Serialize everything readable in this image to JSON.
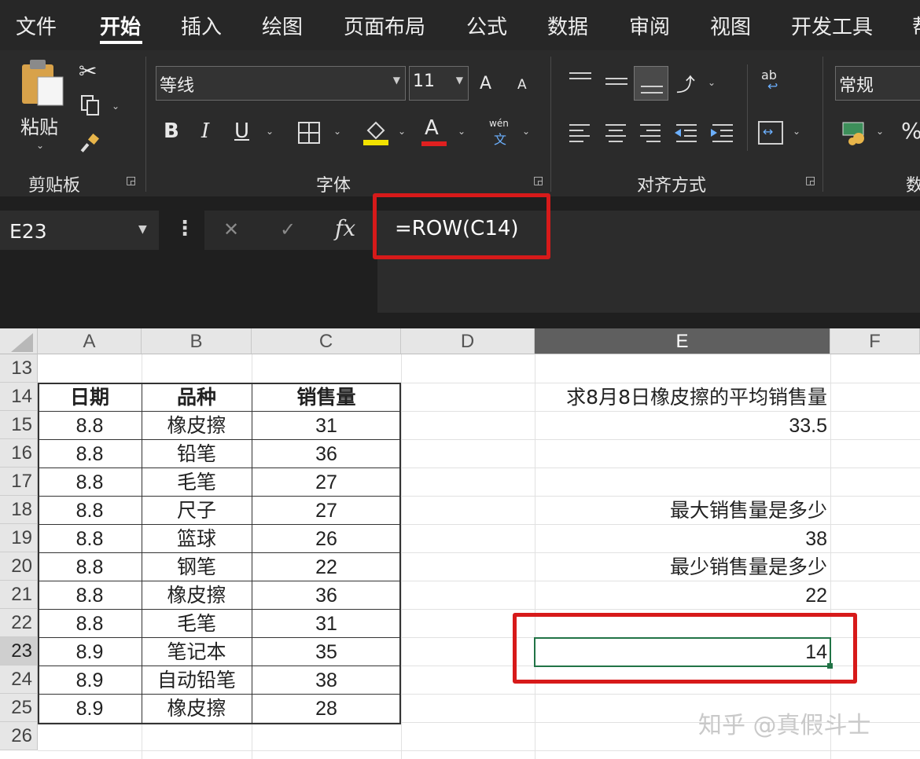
{
  "menu": {
    "tabs": [
      "文件",
      "开始",
      "插入",
      "绘图",
      "页面布局",
      "公式",
      "数据",
      "审阅",
      "视图",
      "开发工具",
      "帮"
    ],
    "active_tab": "开始"
  },
  "ribbon": {
    "clipboard": {
      "paste_label": "粘贴",
      "group_label": "剪贴板"
    },
    "font": {
      "font_name": "等线",
      "font_size": "11",
      "bold": "B",
      "italic": "I",
      "underline": "U",
      "font_color_glyph": "A",
      "grow_glyph": "A",
      "shrink_glyph": "A",
      "phonetic_top": "wén",
      "phonetic_bottom": "文",
      "group_label": "字体"
    },
    "alignment": {
      "group_label": "对齐方式",
      "wrap_glyph": "ab"
    },
    "number": {
      "format": "常规",
      "group_label": "数",
      "percent": "%"
    }
  },
  "formula_bar": {
    "name_box": "E23",
    "more": "⋮",
    "cancel": "✕",
    "enter": "✓",
    "fx": "fx",
    "formula": "=ROW(C14)"
  },
  "columns": [
    "A",
    "B",
    "C",
    "D",
    "E",
    "F"
  ],
  "selected_column": "E",
  "rows": [
    "13",
    "14",
    "15",
    "16",
    "17",
    "18",
    "19",
    "20",
    "21",
    "22",
    "23",
    "24",
    "25",
    "26"
  ],
  "selected_row": "23",
  "table": {
    "headers": [
      "日期",
      "品种",
      "销售量"
    ],
    "rows": [
      [
        "8.8",
        "橡皮擦",
        "31"
      ],
      [
        "8.8",
        "铅笔",
        "36"
      ],
      [
        "8.8",
        "毛笔",
        "27"
      ],
      [
        "8.8",
        "尺子",
        "27"
      ],
      [
        "8.8",
        "篮球",
        "26"
      ],
      [
        "8.8",
        "钢笔",
        "22"
      ],
      [
        "8.8",
        "橡皮擦",
        "36"
      ],
      [
        "8.8",
        "毛笔",
        "31"
      ],
      [
        "8.9",
        "笔记本",
        "35"
      ],
      [
        "8.9",
        "自动铅笔",
        "38"
      ],
      [
        "8.9",
        "橡皮擦",
        "28"
      ]
    ]
  },
  "column_e": {
    "e14": "求8月8日橡皮擦的平均销售量",
    "e15": "33.5",
    "e18": "最大销售量是多少",
    "e19": "38",
    "e20": "最少销售量是多少",
    "e21": "22",
    "e23": "14"
  },
  "watermark": "知乎 @真假斗士",
  "colors": {
    "highlight_red": "#d71a1a",
    "selection_green": "#217346",
    "ribbon_bg": "#2b2b2b"
  }
}
